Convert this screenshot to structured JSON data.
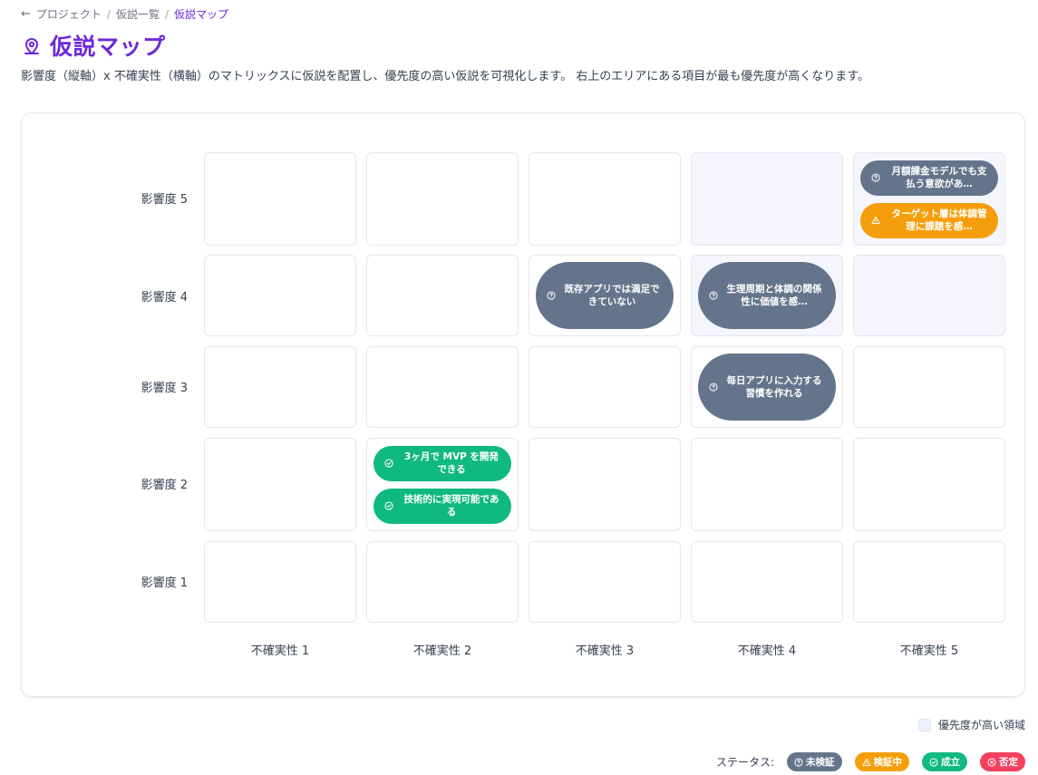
{
  "breadcrumb": {
    "back_icon": "arrow-left-icon",
    "items": [
      "プロジェクト",
      "仮説一覧",
      "仮説マップ"
    ]
  },
  "title": "仮説マップ",
  "title_icon": "map-pin-icon",
  "description": "影響度（縦軸）x 不確実性（横軸）のマトリックスに仮説を配置し、優先度の高い仮説を可視化します。 右上のエリアにある項目が最も優先度が高くなります。",
  "matrix": {
    "row_labels": [
      "影響度 5",
      "影響度 4",
      "影響度 3",
      "影響度 2",
      "影響度 1"
    ],
    "col_labels": [
      "不確実性 1",
      "不確実性 2",
      "不確実性 3",
      "不確実性 4",
      "不確実性 5"
    ],
    "hypotheses": {
      "h1": {
        "text": "月額課金モデルでも支払う意欲があ…",
        "status": "未検証",
        "impact": 5,
        "uncertainty": 5
      },
      "h2": {
        "text": "ターゲット層は体調管理に課題を感…",
        "status": "検証中",
        "impact": 5,
        "uncertainty": 5
      },
      "h3": {
        "text": "既存アプリでは満足できていない",
        "status": "未検証",
        "impact": 4,
        "uncertainty": 3
      },
      "h4": {
        "text": "生理周期と体調の関係性に価値を感…",
        "status": "未検証",
        "impact": 4,
        "uncertainty": 4
      },
      "h5": {
        "text": "毎日アプリに入力する習慣を作れる",
        "status": "未検証",
        "impact": 3,
        "uncertainty": 4
      },
      "h6": {
        "text": "3ヶ月で MVP を開発できる",
        "status": "成立",
        "impact": 2,
        "uncertainty": 2
      },
      "h7": {
        "text": "技術的に実現可能である",
        "status": "成立",
        "impact": 2,
        "uncertainty": 2
      }
    }
  },
  "legend": {
    "priority_label": "優先度が高い領域",
    "status_label": "ステータス:",
    "statuses": {
      "unverified": {
        "label": "未検証",
        "color": "#64748b",
        "icon": "question-circle-icon"
      },
      "verifying": {
        "label": "検証中",
        "color": "#f59e0b",
        "icon": "warning-triangle-icon"
      },
      "valid": {
        "label": "成立",
        "color": "#10b981",
        "icon": "check-circle-icon"
      },
      "denied": {
        "label": "否定",
        "color": "#f43f5e",
        "icon": "x-circle-icon"
      }
    }
  },
  "colors": {
    "accent": "#6d28d9",
    "priority_area": "#f5f6fd"
  }
}
